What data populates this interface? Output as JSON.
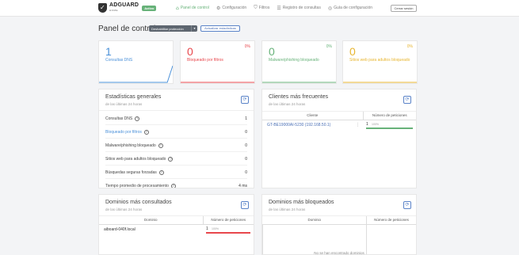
{
  "app": {
    "name": "ADGUARD",
    "sub": "HOME",
    "badge": "Activo"
  },
  "nav": [
    {
      "label": "Panel de control",
      "icon": "home-icon",
      "glyph": "⌂",
      "active": true
    },
    {
      "label": "Configuración",
      "icon": "gear-icon",
      "glyph": "⚙",
      "active": false
    },
    {
      "label": "Filtros",
      "icon": "filter-icon",
      "glyph": "⛉",
      "active": false
    },
    {
      "label": "Registro de consultas",
      "icon": "log-icon",
      "glyph": "☰",
      "active": false
    },
    {
      "label": "Guía de configuración",
      "icon": "guide-icon",
      "glyph": "◎",
      "active": false
    }
  ],
  "logout_label": "Cerrar sesión",
  "page": {
    "title": "Panel de control",
    "disable_protection": "Deshabilitar protección",
    "split_glyph": "▾",
    "refresh_stats": "Actualizar estadísticas"
  },
  "stats": [
    {
      "value": "1",
      "label": "Consultas DNS",
      "pct": "",
      "color": "#4a90d9"
    },
    {
      "value": "0",
      "label": "Bloqueado por filtros",
      "pct": "0%",
      "color": "#e8474c"
    },
    {
      "value": "0",
      "label": "Malware/phishing bloqueado",
      "pct": "0%",
      "color": "#67b279"
    },
    {
      "value": "0",
      "label": "Sitios web para adultos bloqueado",
      "pct": "0%",
      "color": "#e7b52f"
    }
  ],
  "general": {
    "title": "Estadísticas generales",
    "sub": "de las últimas 24 horas",
    "rows": [
      {
        "label": "Consultas DNS",
        "value": "1",
        "color": "#444"
      },
      {
        "label": "Bloqueado por filtros",
        "value": "0",
        "color": "#4a90d9"
      },
      {
        "label": "Malware/phishing bloqueado",
        "value": "0",
        "color": "#444"
      },
      {
        "label": "Sitios web para adultos bloqueado",
        "value": "0",
        "color": "#444"
      },
      {
        "label": "Búsquedas seguras forzadas",
        "value": "0",
        "color": "#444"
      },
      {
        "label": "Tiempo promedio de procesamiento",
        "value": "4 ms",
        "color": "#444"
      }
    ]
  },
  "clients": {
    "title": "Clientes más frecuentes",
    "sub": "de las últimas 24 horas",
    "col1": "Cliente",
    "col2": "Número de peticiones",
    "rows": [
      {
        "name": "GT-BE19000AI-5230 (192.168.50.1)",
        "count": "1",
        "pct": "100%",
        "fraction": 1.0,
        "color": "#67b279"
      }
    ]
  },
  "queried": {
    "title": "Dominios más consultados",
    "sub": "de las últimas 24 horas",
    "col1": "Dominio",
    "col2": "Número de peticiones",
    "rows": [
      {
        "name": "aiboard-040f.local",
        "count": "1",
        "pct": "100%",
        "fraction": 1.0,
        "color": "#e8474c"
      }
    ]
  },
  "blocked": {
    "title": "Dominios más bloqueados",
    "sub": "de las últimas 24 horas",
    "col1": "Dominio",
    "col2": "Número de peticiones",
    "empty": "No se han encontrado dominios"
  }
}
